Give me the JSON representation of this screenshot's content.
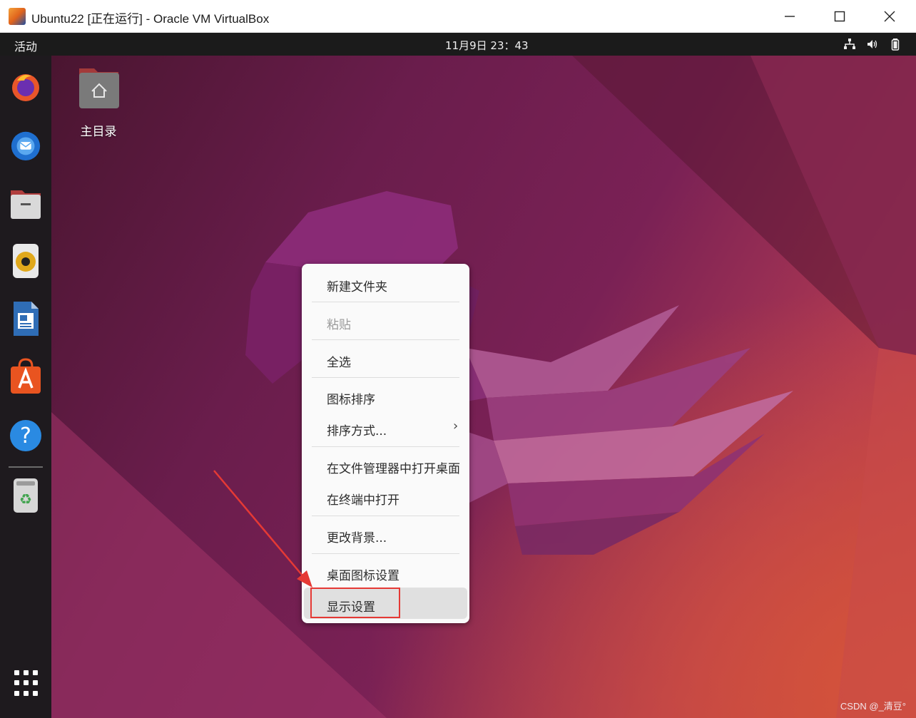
{
  "window": {
    "title": "Ubuntu22 [正在运行] - Oracle VM VirtualBox",
    "controls": [
      "minimize-icon",
      "maximize-icon",
      "close-icon"
    ]
  },
  "topbar": {
    "activities": "活动",
    "clock": "11月9日  23：43",
    "status_icons": [
      "network-icon",
      "volume-icon",
      "battery-icon"
    ]
  },
  "dock": {
    "items": [
      "firefox-icon",
      "thunderbird-icon",
      "files-icon",
      "rhythmbox-icon",
      "libreoffice-writer-icon",
      "software-center-icon",
      "help-icon",
      "trash-icon"
    ],
    "show_apps": "app-grid-icon"
  },
  "desktop": {
    "home_label": "主目录"
  },
  "context_menu": {
    "items": {
      "new_folder": "新建文件夹",
      "paste": "粘贴",
      "select_all": "全选",
      "arrange_icons": "图标排序",
      "sort_by": "排序方式...",
      "open_in_files": "在文件管理器中打开桌面",
      "open_in_terminal": "在终端中打开",
      "change_background": "更改背景...",
      "desktop_icon_settings": "桌面图标设置",
      "display_settings": "显示设置"
    },
    "submenu_indicator": "›",
    "highlighted": "显示设置"
  },
  "annotation": {
    "highlight_color": "#e53935"
  },
  "watermark": "CSDN @_清豆°"
}
